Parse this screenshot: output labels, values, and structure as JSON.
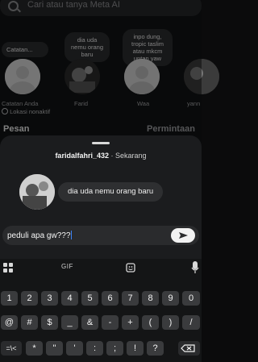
{
  "search": {
    "placeholder": "Cari atau tanya Meta AI"
  },
  "notes": [
    {
      "bubble": "Catatan...",
      "name": "Catatan Anda",
      "sub": "Lokasi nonaktif"
    },
    {
      "bubble": "dia uda nemu orang baru",
      "name": "Farid"
    },
    {
      "bubble": "inpo dung, tropic taslim atau mkcm untan yaw",
      "name": "Waa"
    },
    {
      "name": "yann"
    }
  ],
  "tabs": {
    "messages": "Pesan",
    "requests": "Permintaan"
  },
  "sheet": {
    "username": "faridalfahri_432",
    "dot": "·",
    "time": "Sekarang",
    "note_text": "dia uda nemu orang baru",
    "reply_text": "peduli apa gw???"
  },
  "keyboard": {
    "gif_label": "GIF",
    "row1": [
      "1",
      "2",
      "3",
      "4",
      "5",
      "6",
      "7",
      "8",
      "9",
      "0"
    ],
    "row2": [
      "@",
      "#",
      "$",
      "_",
      "&",
      "-",
      "+",
      "(",
      ")",
      "/"
    ],
    "row3": [
      "=\\<",
      "*",
      "\"",
      "'",
      ":",
      ";",
      "!",
      "?"
    ]
  },
  "colors": {
    "accent_caret": "#3b82f6",
    "sheet_bg": "#1b1c1e"
  }
}
